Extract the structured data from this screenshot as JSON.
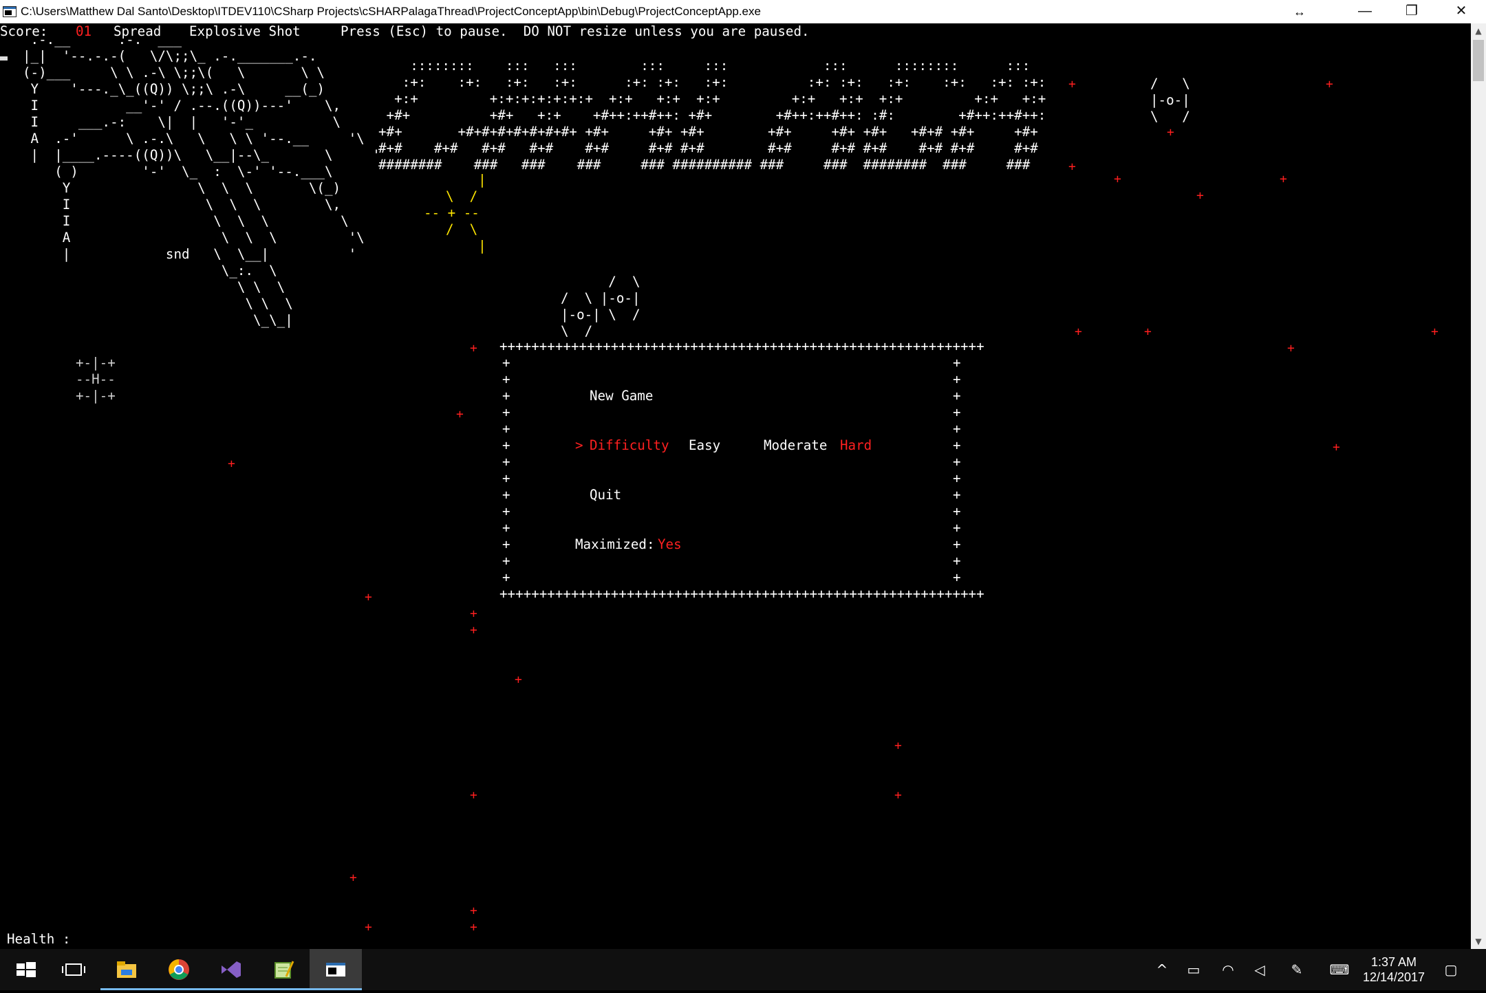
{
  "window": {
    "title": "C:\\Users\\Matthew Dal Santo\\Desktop\\ITDEV110\\CSharp Projects\\cSHARPalagaThread\\ProjectConceptApp\\bin\\Debug\\ProjectConceptApp.exe",
    "minimize": "—",
    "restore": "❐",
    "close": "✕",
    "resize_glyph": "↔"
  },
  "hud": {
    "score_label": "Score:",
    "score_value": "01",
    "powerup1": "Spread",
    "powerup2": "Explosive Shot",
    "message": "Press (Esc) to pause.  DO NOT resize unless you are paused.",
    "health_label": "Health :"
  },
  "art": {
    "ship_lines": [
      " .-.__      .-.  ___",
      "|_|  '--.-.-(   \\/\\;;\\_ .-._______.-.",
      "(-)___     \\ \\ .-\\ \\;;\\(   \\       \\ \\",
      " Y    '---._\\_((Q)) \\;;\\ .-\\     __(_)",
      " I           __'-' / .--.((Q))---'    \\,",
      " I     ___.-:    \\|  |   '-'_          \\",
      " A  .-'      \\ .-.\\   \\   \\ \\ '--.__     '\\",
      " |  |____.----((Q))\\   \\__|--\\_       \\     '",
      "    ( )        '-'  \\_  :  \\-' '--.___\\",
      "     Y                \\  \\  \\       \\(_)",
      "     I                 \\  \\  \\        \\,",
      "     I                  \\  \\  \\         \\",
      "     A                   \\  \\  \\         '\\",
      "     |            snd   \\  \\__|          '",
      "                         \\_:.  \\",
      "                           \\ \\  \\",
      "                            \\ \\  \\",
      "                             \\_\\_|"
    ],
    "logo_lines": [
      "    ::::::::    :::   :::        :::     :::            :::      ::::::::      :::",
      "   :+:    :+:   :+:   :+:      :+: :+:   :+:          :+: :+:   :+:    :+:   :+: :+:",
      "  +:+         +:+:+:+:+:+:+  +:+   +:+  +:+         +:+   +:+  +:+         +:+   +:+",
      " +#+          +#+   +:+    +#++:++#++: +#+        +#++:++#++: :#:        +#++:++#++:",
      "+#+       +#+#+#+#+#+#+#+ +#+     +#+ +#+        +#+     +#+ +#+   +#+# +#+     +#+",
      "#+#    #+#   #+#   #+#    #+#     #+# #+#        #+#     #+# #+#    #+# #+#     #+#",
      "########    ###   ###    ###     ### ########## ###     ###  ########  ###     ###"
    ],
    "burst_lines": [
      "  |",
      "\\  /",
      "-- + --",
      "/  \\",
      "  |"
    ],
    "enemy_right": [
      "/   \\",
      "|-o-|",
      "\\   /"
    ],
    "enemy_pair": [
      "      /  \\",
      "/  \\ |-o-|",
      "|-o-| \\  /",
      "\\  /"
    ],
    "player_ship": [
      "+-|-+",
      "--H--",
      "+-|-+"
    ]
  },
  "menu": {
    "border_top": "+++++++++++++++++++++++++++++++++++++++++++++++++++++++++++++",
    "edge": "+",
    "new_game": "New Game",
    "selector": ">",
    "difficulty": "Difficulty",
    "easy": "Easy",
    "moderate": "Moderate",
    "hard": "Hard",
    "quit": "Quit",
    "maximized_label": "Maximized:",
    "maximized_value": "Yes",
    "star_glyph": "+"
  },
  "taskbar": {
    "apps": [
      "start-icon",
      "task-view-icon",
      "file-explorer-icon",
      "chrome-icon",
      "visual-studio-icon",
      "notepad-icon",
      "console-icon"
    ],
    "time": "1:37 AM",
    "date": "12/14/2017"
  },
  "colors": {
    "accent_red": "#ff2020",
    "burst_yellow": "#ffe600",
    "taskbar_active": "#76b9ed"
  }
}
